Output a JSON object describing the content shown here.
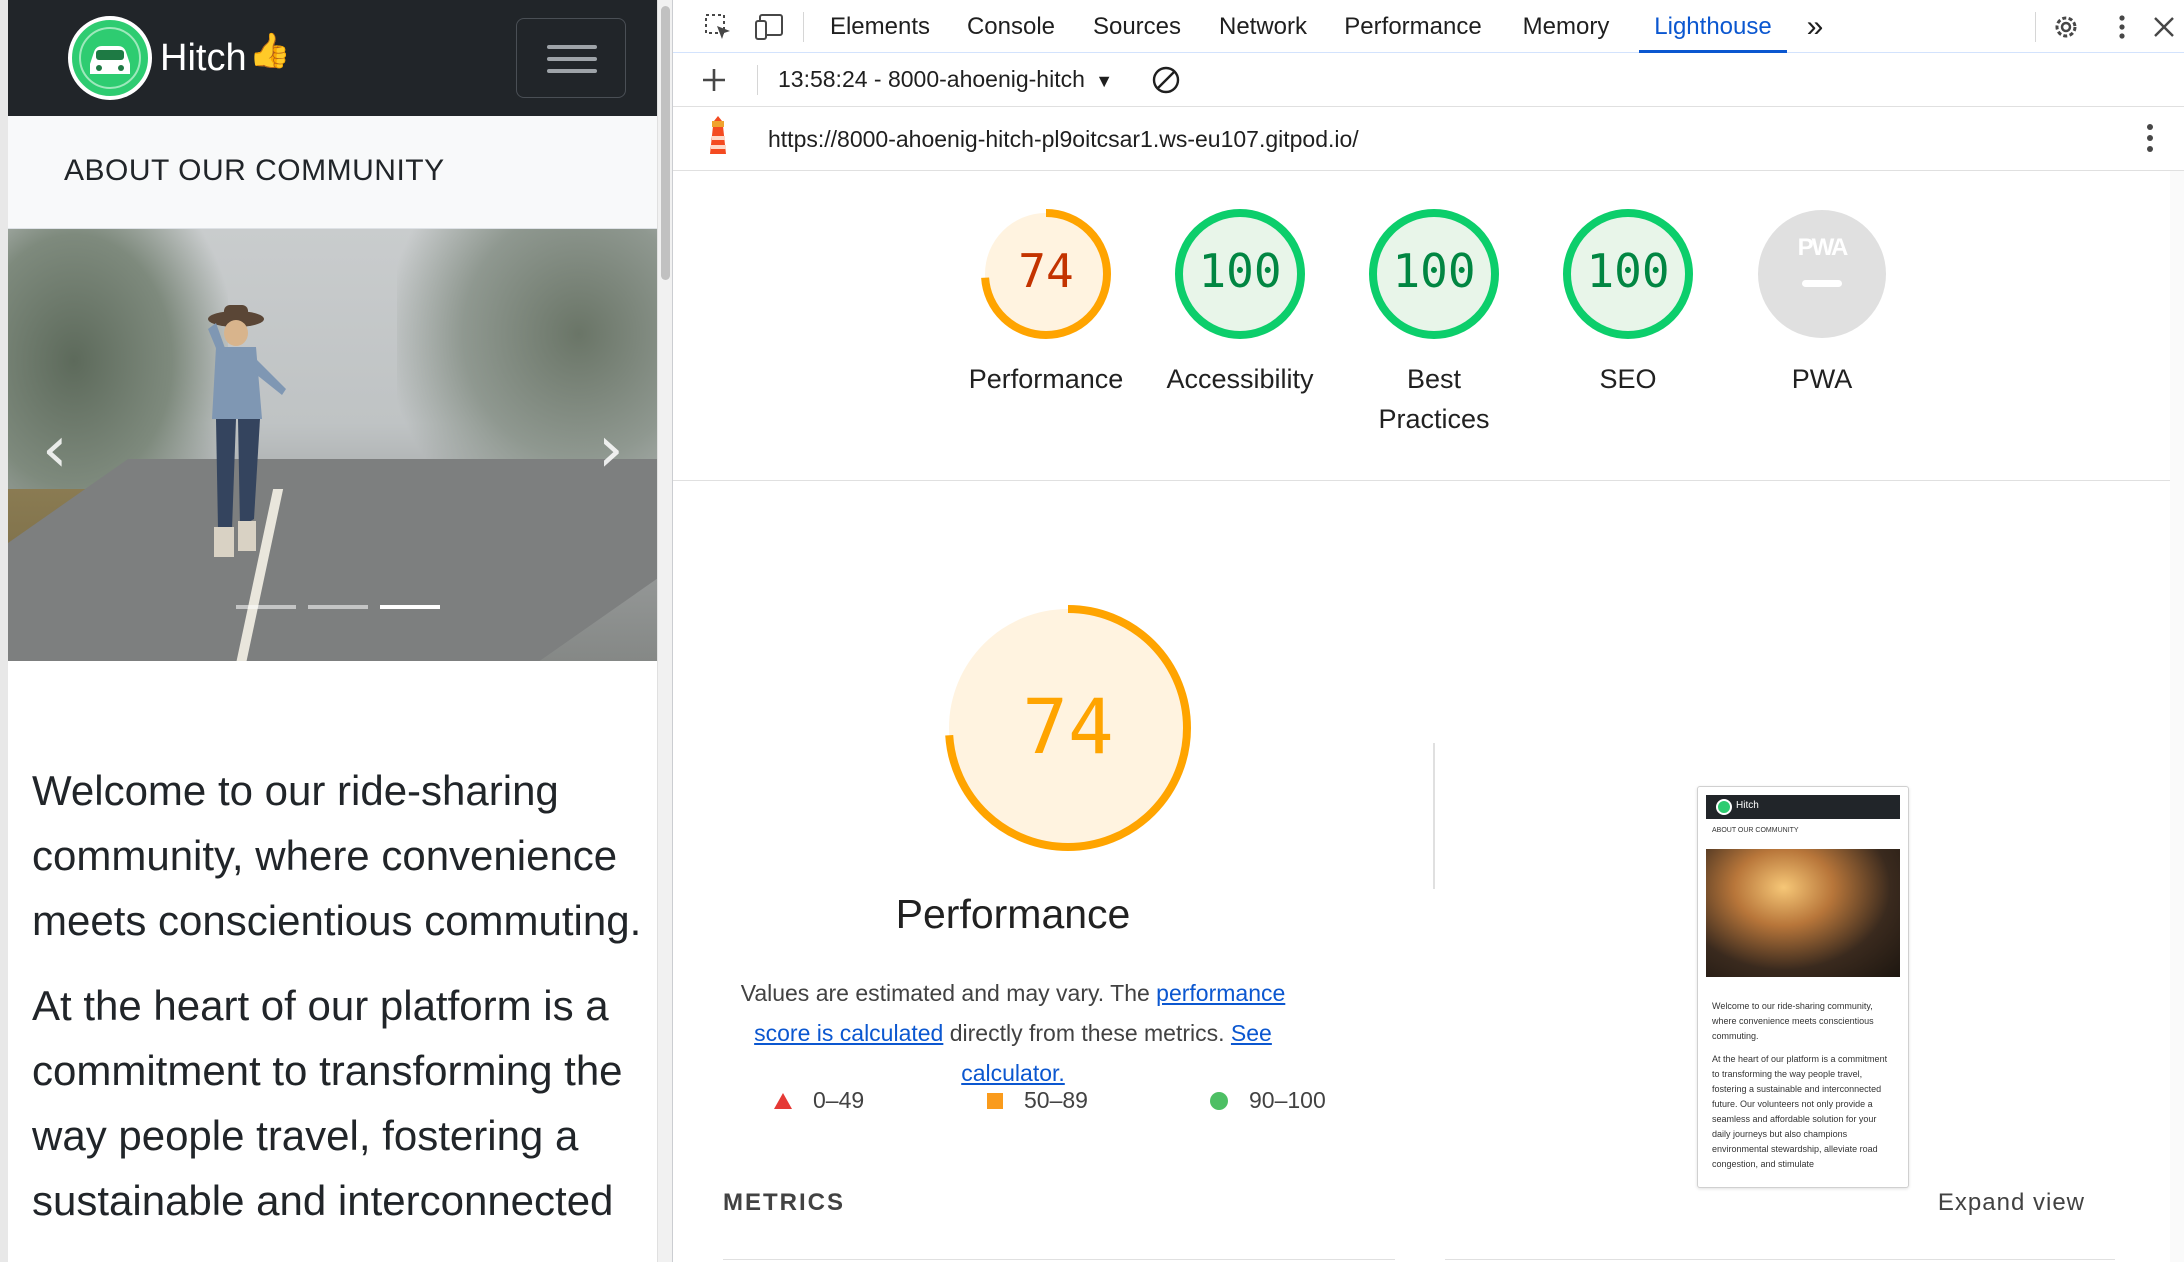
{
  "site": {
    "brand_name": "Hitch",
    "brand_thumb": "👍",
    "section_title": "ABOUT OUR COMMUNITY",
    "carousel_prev": "‹",
    "carousel_next": "›",
    "carousel_active_index": 2,
    "paragraph_1": "Welcome to our ride-sharing community, where convenience meets conscientious commuting.",
    "paragraph_2": "At the heart of our platform is a commitment to transforming the way people travel, fostering a sustainable and interconnected"
  },
  "devtools": {
    "tabs": [
      "Elements",
      "Console",
      "Sources",
      "Network",
      "Performance",
      "Memory",
      "Lighthouse"
    ],
    "active_tab": "Lighthouse",
    "more_tabs": "»",
    "report_selector": "13:58:24 - 8000-ahoenig-hitch",
    "url": "https://8000-ahoenig-hitch-pl9oitcsar1.ws-eu107.gitpod.io/"
  },
  "lighthouse": {
    "categories": [
      {
        "label": "Performance",
        "score": "74",
        "fraction": 0.74,
        "color": "#ffa400",
        "text_color": "#c33300",
        "bg": "#fff3e0"
      },
      {
        "label": "Accessibility",
        "score": "100",
        "fraction": 1.0,
        "color": "#0cce6b",
        "text_color": "#018642",
        "bg": "#e8f5e9"
      },
      {
        "label": "Best Practices",
        "score": "100",
        "fraction": 1.0,
        "color": "#0cce6b",
        "text_color": "#018642",
        "bg": "#e8f5e9"
      },
      {
        "label": "SEO",
        "score": "100",
        "fraction": 1.0,
        "color": "#0cce6b",
        "text_color": "#018642",
        "bg": "#e8f5e9"
      },
      {
        "label": "PWA",
        "score": "PWA",
        "fraction": null,
        "color": "#cccccc",
        "text_color": "#ffffff",
        "bg": "#e0e0e0"
      }
    ],
    "performance": {
      "score": "74",
      "fraction": 0.74,
      "title": "Performance",
      "desc_prefix": "Values are estimated and may vary. The ",
      "desc_link1": "performance score is calculated",
      "desc_middle": " directly from these metrics. ",
      "desc_link2": "See calculator."
    },
    "legend": [
      {
        "range": "0–49",
        "shape": "triangle",
        "color": "#e53935"
      },
      {
        "range": "50–89",
        "shape": "square",
        "color": "#fa9b1c"
      },
      {
        "range": "90–100",
        "shape": "circle",
        "color": "#4dbf64"
      }
    ],
    "thumbnail": {
      "brand": "Hitch",
      "section": "ABOUT OUR COMMUNITY",
      "p1": "Welcome to our ride-sharing community, where convenience meets conscientious commuting.",
      "p2": "At the heart of our platform is a commitment to transforming the way people travel, fostering a sustainable and interconnected future. Our volunteers not only provide a seamless and affordable solution for your daily journeys but also champions environmental stewardship, alleviate road congestion, and stimulate"
    },
    "metrics_title": "METRICS",
    "expand_label": "Expand view"
  }
}
